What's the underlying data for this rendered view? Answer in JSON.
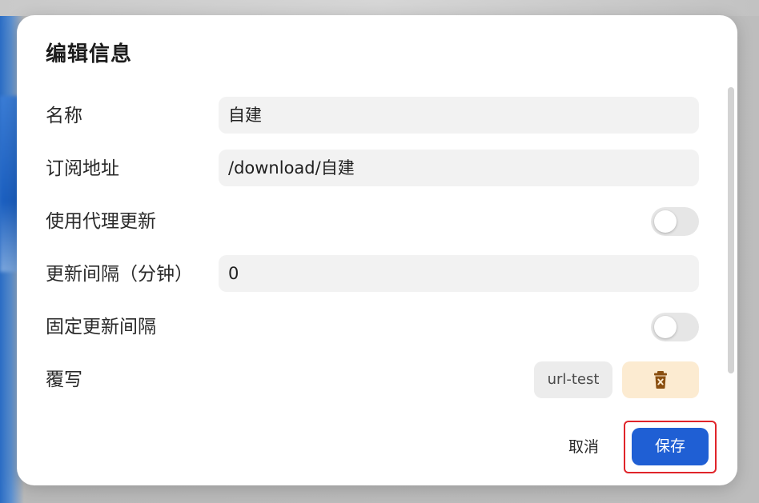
{
  "dialog": {
    "title": "编辑信息",
    "rows": {
      "name": {
        "label": "名称",
        "value": "自建"
      },
      "url": {
        "label": "订阅地址",
        "value": "/download/自建"
      },
      "proxy": {
        "label": "使用代理更新",
        "enabled": false
      },
      "interval": {
        "label": "更新间隔（分钟）",
        "value": "0"
      },
      "fixed": {
        "label": "固定更新间隔",
        "enabled": false
      },
      "override": {
        "label": "覆写",
        "chip": "url-test",
        "delete_icon": "trash-icon"
      }
    },
    "buttons": {
      "cancel": "取消",
      "save": "保存"
    }
  },
  "colors": {
    "primary": "#1f5fd4",
    "delete_bg": "#fcebd1",
    "delete_icon": "#8a4f10",
    "highlight_border": "#e0242a"
  }
}
